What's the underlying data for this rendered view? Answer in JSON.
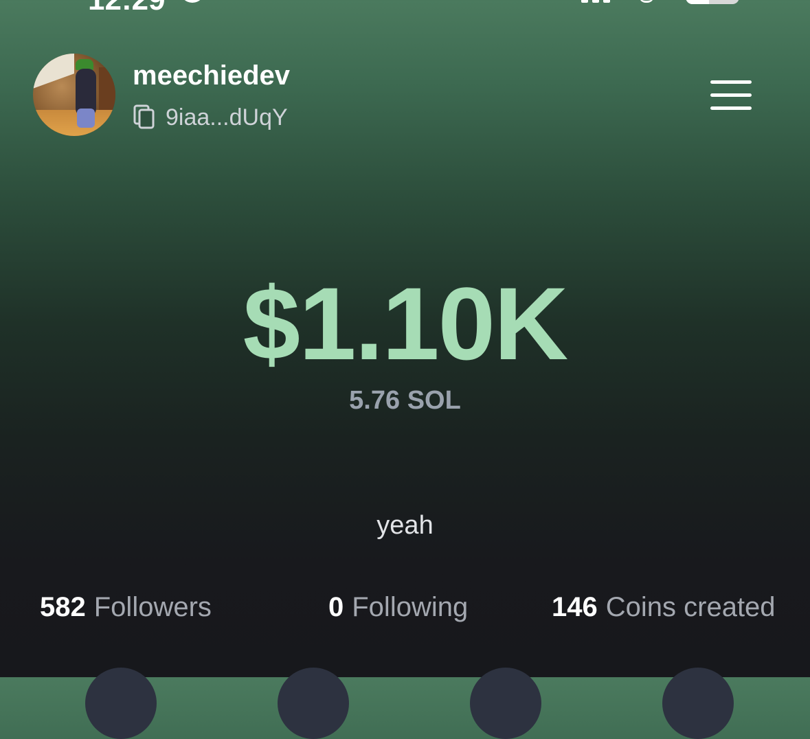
{
  "status_bar": {
    "time": "12:29",
    "battery_level": 0.44
  },
  "profile": {
    "username": "meechiedev",
    "wallet_address": "9iaa...dUqY",
    "avatar": "game-character-avatar",
    "bio": "yeah"
  },
  "balance": {
    "usd": "$1.10K",
    "sol": "5.76 SOL"
  },
  "stats": {
    "followers_count": "582",
    "followers_label": "Followers",
    "following_count": "0",
    "following_label": "Following",
    "coins_count": "146",
    "coins_label": "Coins created"
  },
  "icons": {
    "copy": "copy-icon",
    "menu": "hamburger-menu-icon"
  },
  "colors": {
    "balance_green": "#a6dcb5",
    "background_top": "#4b7a5e",
    "background_bottom": "#17181c"
  }
}
